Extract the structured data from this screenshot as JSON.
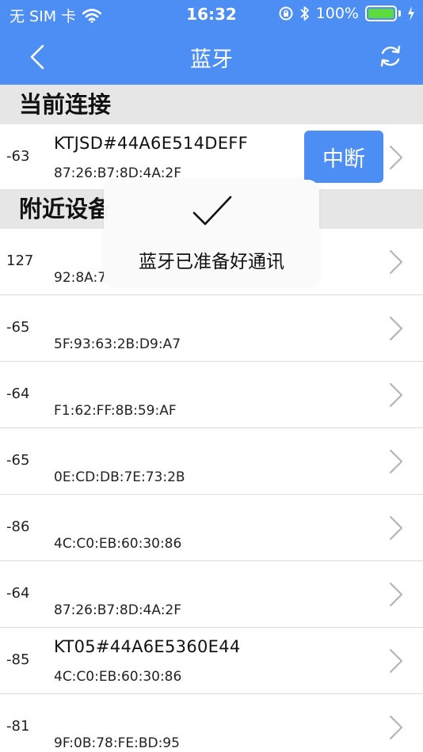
{
  "status": {
    "carrier": "无 SIM 卡",
    "time": "16:32",
    "battery_percent": "100%",
    "battery_level": 1.0
  },
  "nav": {
    "title": "蓝牙"
  },
  "sections": {
    "current": "当前连接",
    "nearby": "附近设备"
  },
  "current_device": {
    "rssi": "-63",
    "name": "KTJSD#44A6E514DEFF",
    "mac": "87:26:B7:8D:4A:2F",
    "disconnect_label": "中断"
  },
  "nearby_devices": [
    {
      "rssi": "127",
      "name": "",
      "mac": "92:8A:7"
    },
    {
      "rssi": "-65",
      "name": "",
      "mac": "5F:93:63:2B:D9:A7"
    },
    {
      "rssi": "-64",
      "name": "",
      "mac": "F1:62:FF:8B:59:AF"
    },
    {
      "rssi": "-65",
      "name": "",
      "mac": "0E:CD:DB:7E:73:2B"
    },
    {
      "rssi": "-86",
      "name": "",
      "mac": "4C:C0:EB:60:30:86"
    },
    {
      "rssi": "-64",
      "name": "",
      "mac": "87:26:B7:8D:4A:2F"
    },
    {
      "rssi": "-85",
      "name": "KT05#44A6E5360E44",
      "mac": "4C:C0:EB:60:30:86"
    },
    {
      "rssi": "-81",
      "name": "",
      "mac": "9F:0B:78:FE:BD:95"
    }
  ],
  "toast": {
    "message": "蓝牙已准备好通讯"
  },
  "colors": {
    "accent": "#4d8ef5",
    "battery": "#5cdc3c",
    "section_bg": "#e6e6e6"
  }
}
